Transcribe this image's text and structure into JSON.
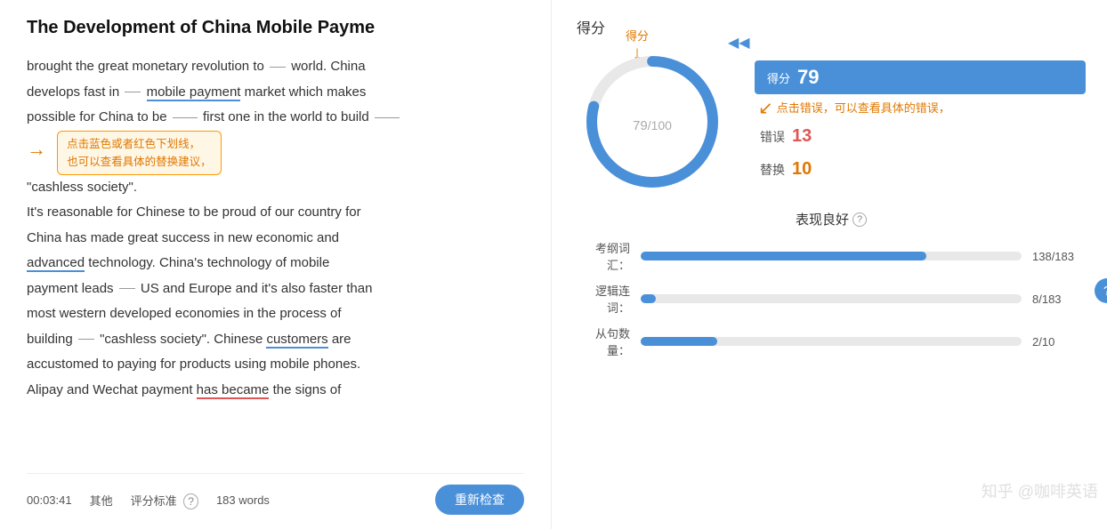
{
  "header": {
    "title": "The Development of China Mobile Payme"
  },
  "article": {
    "body_segments": [
      {
        "type": "text",
        "content": "brought the great monetary revolution to"
      },
      {
        "type": "blank",
        "size": "sm"
      },
      {
        "type": "text",
        "content": "world. China"
      },
      {
        "type": "text",
        "content": "develops fast in"
      },
      {
        "type": "blank",
        "size": "sm"
      },
      {
        "type": "underline_blue",
        "content": "mobile payment"
      },
      {
        "type": "text",
        "content": "market which makes"
      },
      {
        "type": "text",
        "content": "possible for China to be"
      },
      {
        "type": "blank",
        "size": "md"
      },
      {
        "type": "text",
        "content": "first one in the world to build"
      },
      {
        "type": "underline_blue",
        "content": ""
      },
      {
        "type": "text",
        "content": "\"cashless society\"."
      },
      {
        "type": "tooltip",
        "content": "点击蓝色或者红色下划线，\n也可以查看具体的替换建议。"
      },
      {
        "type": "newline"
      },
      {
        "type": "text",
        "content": "It's reasonable for Chinese to be proud of our country for"
      },
      {
        "type": "newline"
      },
      {
        "type": "text",
        "content": "China has made great success in new economic and"
      },
      {
        "type": "newline"
      },
      {
        "type": "underline_blue",
        "content": "advanced"
      },
      {
        "type": "text",
        "content": "technology. China's technology of mobile"
      },
      {
        "type": "newline"
      },
      {
        "type": "text",
        "content": "payment leads"
      },
      {
        "type": "blank",
        "size": "sm"
      },
      {
        "type": "text",
        "content": "US and Europe and it's also faster than"
      },
      {
        "type": "newline"
      },
      {
        "type": "text",
        "content": "most western developed economies in the process of"
      },
      {
        "type": "newline"
      },
      {
        "type": "text",
        "content": "building"
      },
      {
        "type": "blank",
        "size": "sm"
      },
      {
        "type": "text",
        "content": "\"cashless society\". Chinese"
      },
      {
        "type": "underline_blue",
        "content": "customers"
      },
      {
        "type": "text",
        "content": "are"
      },
      {
        "type": "newline"
      },
      {
        "type": "text",
        "content": "accustomed to paying for products using mobile phones."
      },
      {
        "type": "newline"
      },
      {
        "type": "text",
        "content": "Alipay and Wechat payment"
      },
      {
        "type": "underline_red",
        "content": "has became"
      },
      {
        "type": "text",
        "content": "the signs of"
      }
    ]
  },
  "bottom_bar": {
    "time": "00:03:41",
    "category": "其他",
    "rating_label": "评分标准",
    "word_count": "183 words",
    "recheck_btn": "重新检查"
  },
  "score_panel": {
    "top_label": "得分",
    "arrow_label": "得分",
    "score": "79",
    "max_score": "100",
    "back_arrow": "◀◀",
    "badge_score_label": "得分",
    "badge_score_val": "79",
    "error_label": "错误",
    "error_val": "13",
    "replace_label": "替换",
    "replace_val": "10",
    "hint_right": "点击错误，可以查看具体的错误，",
    "perf_title": "表现良好",
    "perf_rows": [
      {
        "label": "考纲词汇：",
        "bar_pct": 75,
        "value": "138/183"
      },
      {
        "label": "逻辑连词：",
        "bar_pct": 4,
        "value": "8/183"
      },
      {
        "label": "从句数量：",
        "bar_pct": 20,
        "value": "2/10"
      }
    ],
    "watermark": "知乎 @咖啡英语",
    "help_circle": "?"
  }
}
